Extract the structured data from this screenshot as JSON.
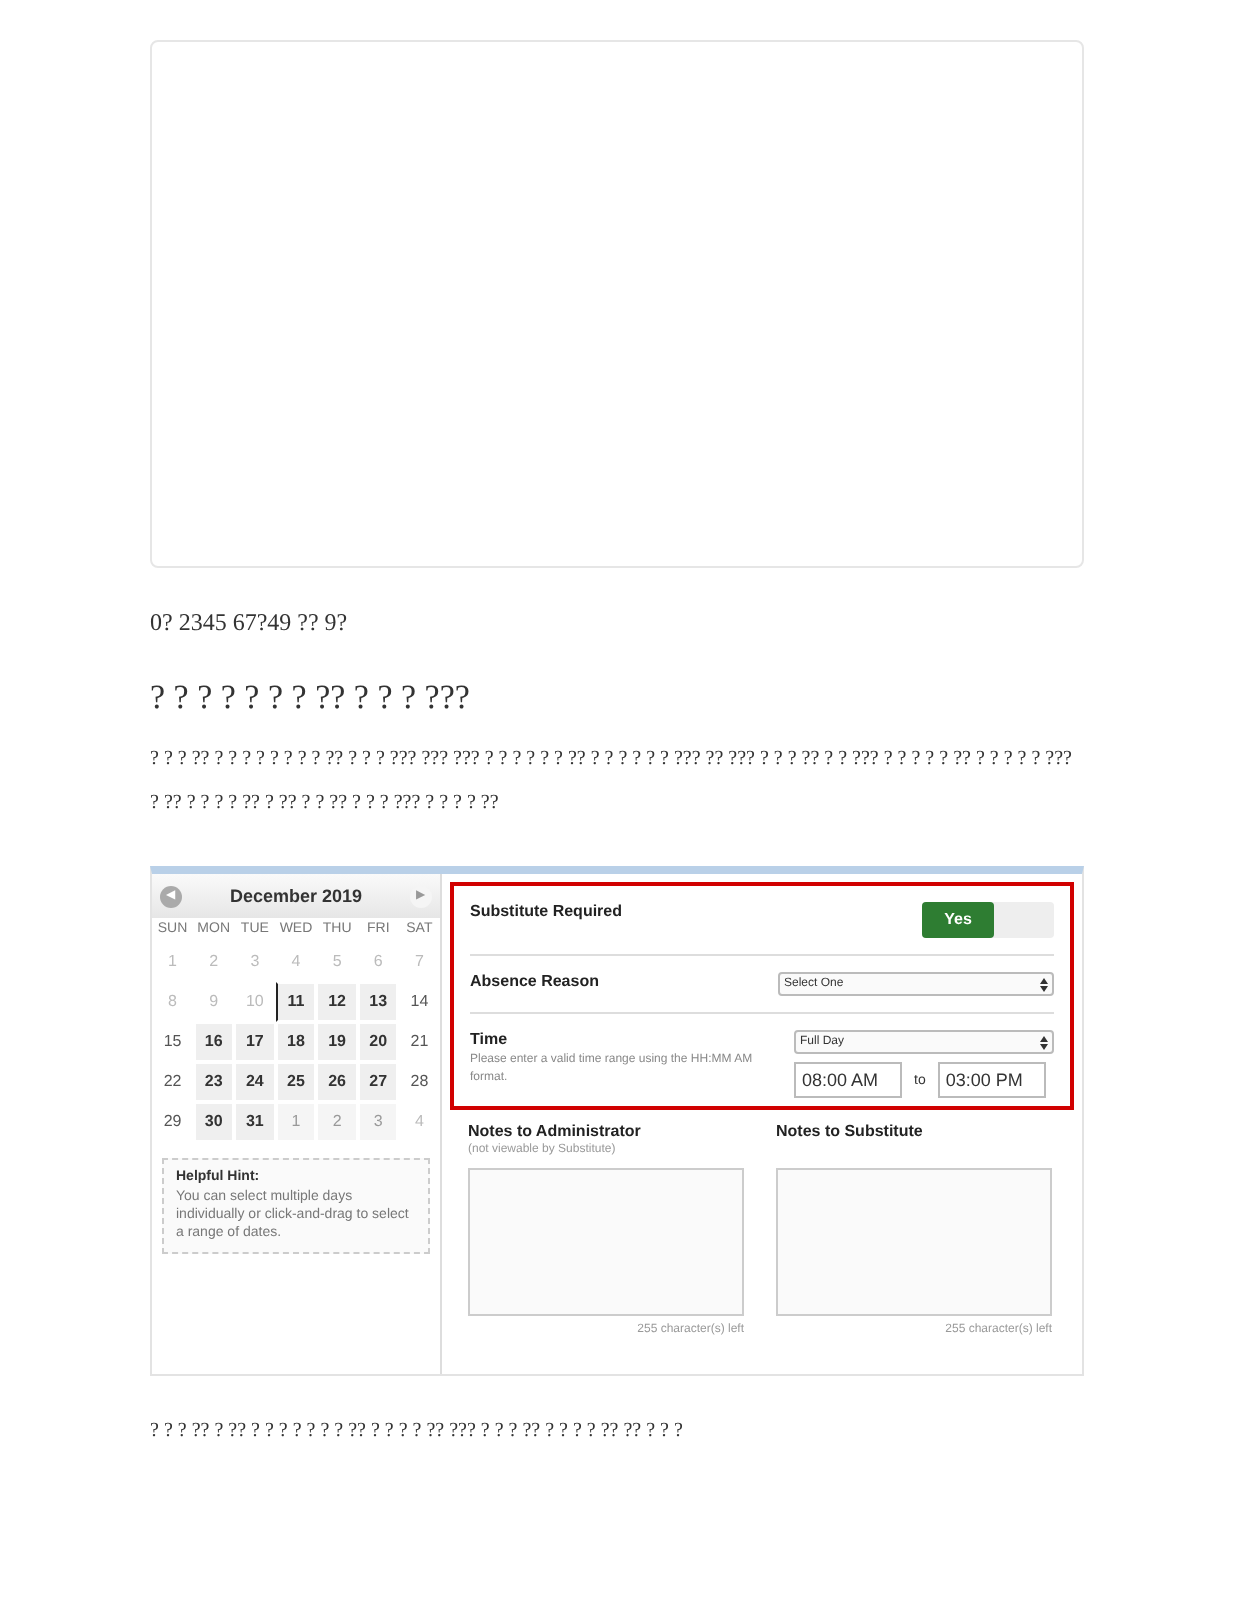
{
  "intro_line": "0?  2345 67?49 ?? 9?",
  "heading": "? ? ? ? ? ? ? ?? ?  ? ? ???",
  "paragraph": "? ? ? ?? ? ? ? ? ? ? ? ? ?? ? ? ? ??? ??? ??? ? ? ? ? ? ? ?? ? ? ? ? ? ? ??? ??  ??? ? ? ? ?? ? ? ??? ? ? ? ? ? ?? ? ? ? ? ? ??? ? ?? ? ? ? ? ?? ? ?? ? ? ?? ? ? ? ??? ? ? ? ? ??",
  "screenshot": {
    "calendar": {
      "month": "December 2019",
      "prev": "◀",
      "next": "▶",
      "weekdays": [
        "SUN",
        "MON",
        "TUE",
        "WED",
        "THU",
        "FRI",
        "SAT"
      ],
      "weeks": [
        [
          {
            "day": "1",
            "kind": "past",
            "today": false
          },
          {
            "day": "2",
            "kind": "past",
            "today": false
          },
          {
            "day": "3",
            "kind": "past",
            "today": false
          },
          {
            "day": "4",
            "kind": "past",
            "today": false
          },
          {
            "day": "5",
            "kind": "past",
            "today": false
          },
          {
            "day": "6",
            "kind": "past",
            "today": false
          },
          {
            "day": "7",
            "kind": "past",
            "today": false
          }
        ],
        [
          {
            "day": "8",
            "kind": "past",
            "today": false
          },
          {
            "day": "9",
            "kind": "past",
            "today": false
          },
          {
            "day": "10",
            "kind": "past",
            "today": false
          },
          {
            "day": "11",
            "kind": "open",
            "today": true
          },
          {
            "day": "12",
            "kind": "open",
            "today": false
          },
          {
            "day": "13",
            "kind": "open",
            "today": false
          },
          {
            "day": "14",
            "kind": "weekend",
            "today": false
          }
        ],
        [
          {
            "day": "15",
            "kind": "weekend",
            "today": false
          },
          {
            "day": "16",
            "kind": "open",
            "today": false
          },
          {
            "day": "17",
            "kind": "open",
            "today": false
          },
          {
            "day": "18",
            "kind": "open",
            "today": false
          },
          {
            "day": "19",
            "kind": "open",
            "today": false
          },
          {
            "day": "20",
            "kind": "open",
            "today": false
          },
          {
            "day": "21",
            "kind": "weekend",
            "today": false
          }
        ],
        [
          {
            "day": "22",
            "kind": "weekend",
            "today": false
          },
          {
            "day": "23",
            "kind": "open",
            "today": false
          },
          {
            "day": "24",
            "kind": "open",
            "today": false
          },
          {
            "day": "25",
            "kind": "open",
            "today": false
          },
          {
            "day": "26",
            "kind": "open",
            "today": false
          },
          {
            "day": "27",
            "kind": "open",
            "today": false
          },
          {
            "day": "28",
            "kind": "weekend",
            "today": false
          }
        ],
        [
          {
            "day": "29",
            "kind": "weekend",
            "today": false
          },
          {
            "day": "30",
            "kind": "open",
            "today": false
          },
          {
            "day": "31",
            "kind": "open",
            "today": false
          },
          {
            "day": "1",
            "kind": "next",
            "today": false
          },
          {
            "day": "2",
            "kind": "next",
            "today": false
          },
          {
            "day": "3",
            "kind": "next",
            "today": false
          },
          {
            "day": "4",
            "kind": "past",
            "today": false
          }
        ]
      ]
    },
    "hint": {
      "title": "Helpful Hint:",
      "text": "You can select multiple days individually or click-and-drag to select a range of dates."
    },
    "substitute": {
      "label": "Substitute Required",
      "toggle": {
        "label": "Yes",
        "on": true
      }
    },
    "reason": {
      "label": "Absence Reason",
      "value": "Select One"
    },
    "time": {
      "label": "Time",
      "help": "Please enter a valid time range using the HH:MM AM format.",
      "value": "Full Day",
      "from": "08:00 AM",
      "separator": "to",
      "to": "03:00 PM"
    },
    "notes": [
      {
        "label": "Notes to Administrator",
        "sublabel": "(not viewable by Substitute)",
        "counter": "255 character(s) left"
      },
      {
        "label": "Notes to Substitute",
        "counter": "255 character(s) left"
      }
    ]
  },
  "footer_line": "? ? ? ?? ? ?? ? ? ? ? ? ?  ? ?? ? ? ? ? ?? ??? ? ? ? ?? ? ? ? ? ?? ??  ? ? ?"
}
